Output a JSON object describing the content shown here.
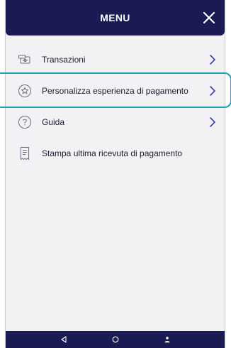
{
  "header": {
    "title": "MENU",
    "close_icon": "close-icon"
  },
  "menu": {
    "items": [
      {
        "label": "Transazioni",
        "icon": "transactions-icon"
      },
      {
        "label": "Personalizza esperienza di pagamento",
        "icon": "star-badge-icon"
      },
      {
        "label": "Guida",
        "icon": "help-icon"
      },
      {
        "label": "Stampa ultima ricevuta di pagamento",
        "icon": "receipt-icon"
      }
    ]
  },
  "navbar": {
    "buttons": [
      "back-icon",
      "home-icon",
      "user-icon"
    ]
  },
  "colors": {
    "header_bg": "#1a1b52",
    "accent": "#3a3fb0",
    "highlight": "#1aa3b8",
    "background": "#f2f2f5"
  }
}
